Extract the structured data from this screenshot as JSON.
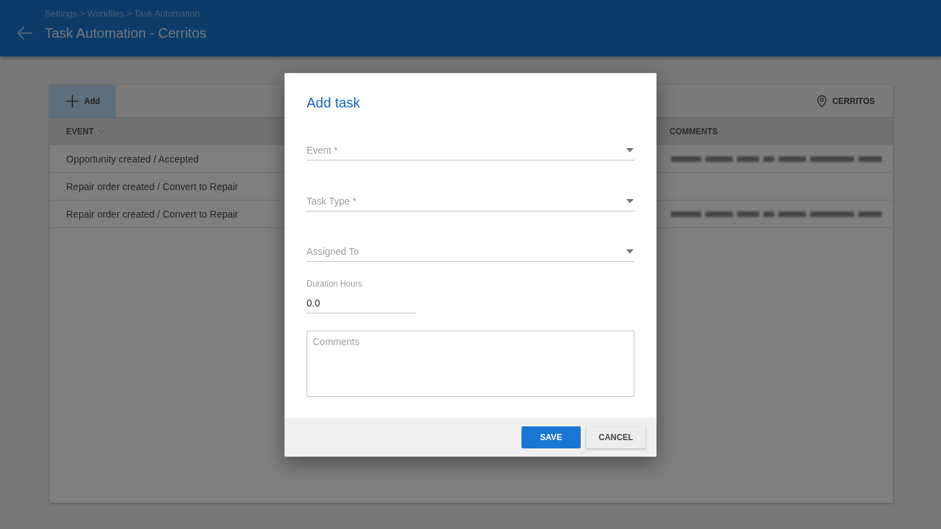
{
  "header": {
    "breadcrumb": "Settings > Workfiles > Task Automation",
    "title": "Task Automation - Cerritos"
  },
  "toolbar": {
    "add_button": "Add",
    "location": "CERRITOS"
  },
  "table": {
    "columns": [
      {
        "label": "EVENT",
        "sorted": true
      },
      {
        "label": "COMMENTS",
        "sorted": false
      }
    ],
    "rows": [
      {
        "event": "Opportunity created / Accepted",
        "comment_blurred": true
      },
      {
        "event": "Repair order created / Convert to Repair",
        "comment_blurred": false
      },
      {
        "event": "Repair order created / Convert to Repair",
        "comment_blurred": true
      }
    ]
  },
  "dialog": {
    "title": "Add task",
    "fields": [
      {
        "kind": "select",
        "placeholder": "Event *"
      },
      {
        "kind": "select",
        "placeholder": "Task Type *"
      },
      {
        "kind": "select",
        "placeholder": "Assigned To"
      },
      {
        "kind": "number",
        "label": "Duration Hours",
        "value": "0.0"
      },
      {
        "kind": "textarea",
        "placeholder": "Comments"
      }
    ],
    "buttons": [
      {
        "kind": "save",
        "label": "SAVE"
      },
      {
        "kind": "cancel",
        "label": "CANCEL"
      }
    ]
  }
}
